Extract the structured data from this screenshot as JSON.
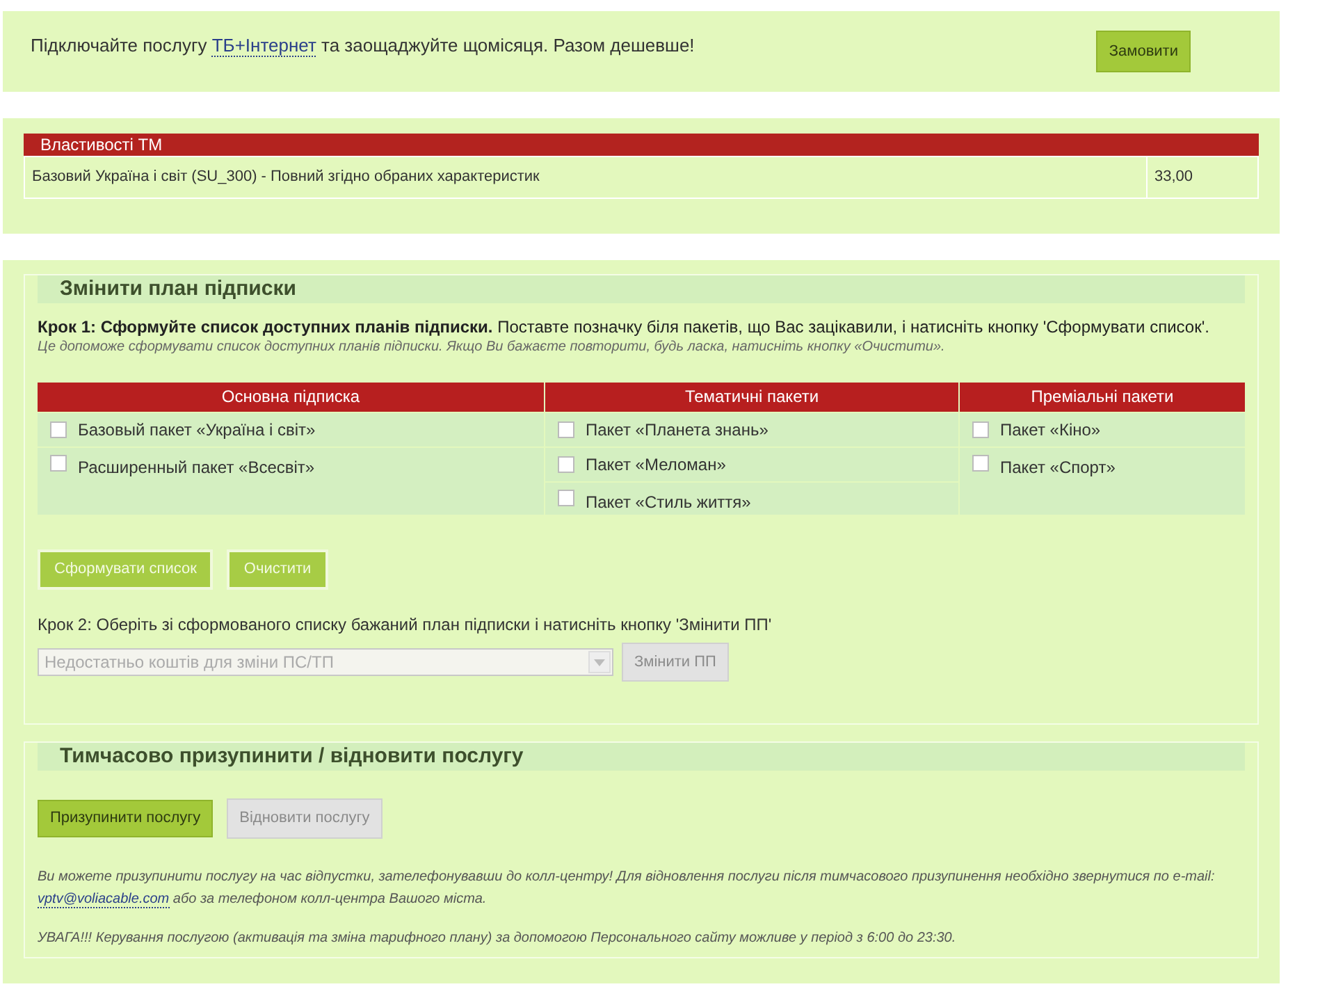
{
  "promo": {
    "text_before": "Підключайте послугу",
    "link": "ТБ+Інтернет",
    "text_after": "та заощаджуйте щомісяця. Разом дешевше!",
    "button": "Замовити"
  },
  "tm_properties": {
    "title": "Властивості ТМ",
    "rows": [
      {
        "name": "Базовий Україна і світ (SU_300) - Повний згідно обраних характеристик",
        "price": "33,00"
      }
    ]
  },
  "change_plan": {
    "title": "Змінити план підписки",
    "step1": "**Крок 1: Сформуйте список доступних планів підписки.** Поставте позначку біля пакетів, що Вас зацікавили, і натисніть кнопку 'Сформувати список'.",
    "hint": "Це допоможе сформувати список доступних планів підписки. Якщо Ви бажаєте повторити, будь ласка, натисніть кнопку «Очистити».",
    "columns": [
      {
        "title": "Основна підписка",
        "items": [
          {
            "label": "Базовый пакет «Україна і світ»",
            "checked": false
          },
          {
            "label": "Расширенный пакет «Всесвіт»",
            "checked": false
          }
        ]
      },
      {
        "title": "Тематичні пакети",
        "items": [
          {
            "label": "Пакет «Планета знань»",
            "checked": false
          },
          {
            "label": "Пакет «Меломан»",
            "checked": false
          },
          {
            "label": "Пакет «Стиль життя»",
            "checked": false
          }
        ]
      },
      {
        "title": "Преміальні пакети",
        "items": [
          {
            "label": "Пакет «Кіно»",
            "checked": false
          },
          {
            "label": "Пакет «Спорт»",
            "checked": false
          }
        ]
      }
    ],
    "buttons": [
      {
        "label": "Сформувати список",
        "disabled": false
      },
      {
        "label": "Очистити",
        "disabled": false
      }
    ],
    "step2": "Крок 2: Оберіть зі сформованого списку бажаний план підписки і натисніть кнопку 'Змінити ПП'",
    "select": {
      "value": "Недостатньо коштів для зміни ПС/ТП",
      "disabled": true
    },
    "submit": {
      "label": "Змінити ПП",
      "disabled": true
    }
  },
  "suspend": {
    "title": "Тимчасово призупинити / відновити послугу",
    "buttons": [
      {
        "label": "Призупинити послугу",
        "disabled": false
      },
      {
        "label": "Відновити послугу",
        "disabled": true
      }
    ],
    "note_before": "Ви можете призупинити послугу на час відпустки, зателефонувавши до колл-центру! Для відновлення послуги після тимчасового призупинення необхідно звернутися по e-mail:",
    "note_link": "vptv@voliacable.com",
    "note_after": "або за телефоном колл-центра Вашого міста.",
    "warning": "УВАГА!!! Керування послугою (активація та зміна тарифного плану) за допомогою Персонального сайту можливе у період з 6:00 до 23:30."
  }
}
